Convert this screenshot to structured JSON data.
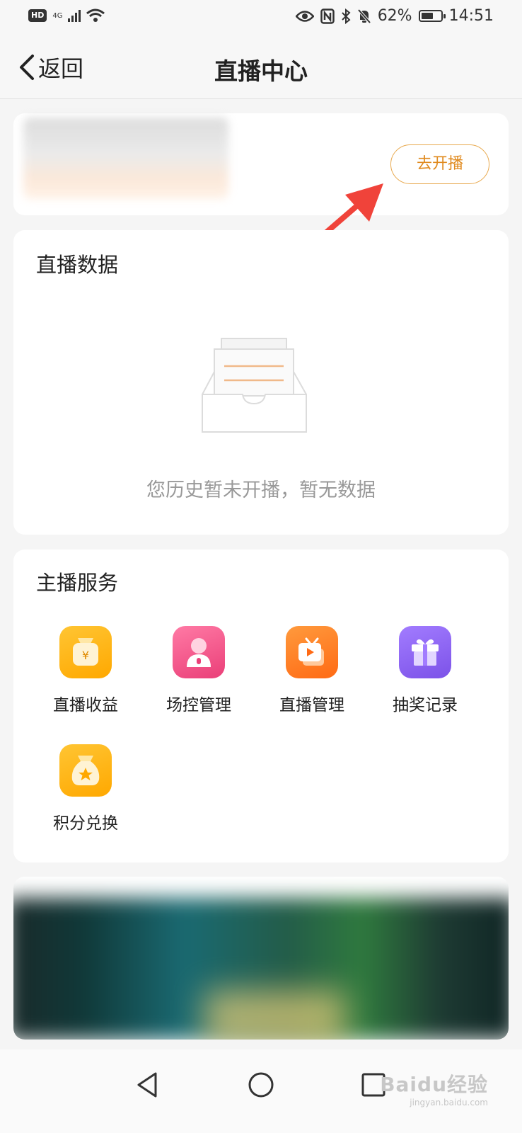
{
  "status_bar": {
    "hd": "HD",
    "network": "4G",
    "battery": "62%",
    "battery_level": 0.62,
    "time": "14:51"
  },
  "nav": {
    "back_label": "返回",
    "title": "直播中心"
  },
  "profile": {
    "start_button": "去开播"
  },
  "live_data": {
    "title": "直播数据",
    "empty_text": "您历史暂未开播，暂无数据"
  },
  "services": {
    "title": "主播服务",
    "items": [
      {
        "label": "直播收益",
        "icon": "money-bag-icon",
        "color": "#ffb300"
      },
      {
        "label": "场控管理",
        "icon": "person-icon",
        "color": "#f0568a"
      },
      {
        "label": "直播管理",
        "icon": "tv-icon",
        "color": "#ff7a1a"
      },
      {
        "label": "抽奖记录",
        "icon": "gift-icon",
        "color": "#8c63ee"
      },
      {
        "label": "积分兑换",
        "icon": "star-bag-icon",
        "color": "#ffb300"
      }
    ]
  },
  "watermark": {
    "text": "Baidu经验",
    "sub": "jingyan.baidu.com"
  },
  "colors": {
    "accent": "#e08a1e",
    "arrow": "#f0433a"
  }
}
